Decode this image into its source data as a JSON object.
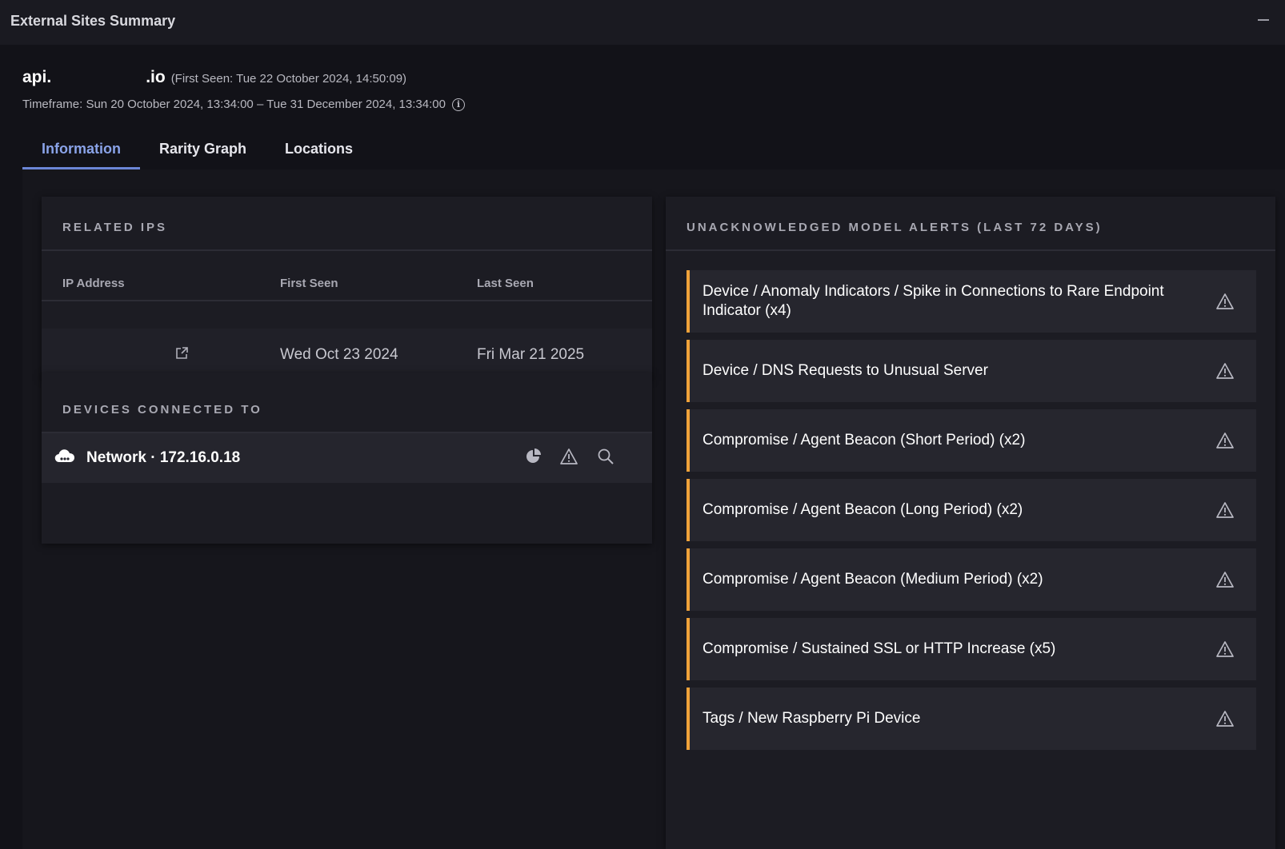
{
  "window": {
    "title": "External Sites Summary"
  },
  "site": {
    "host_prefix": "api.",
    "host_suffix": ".io",
    "first_seen": "(First Seen: Tue 22 October 2024, 14:50:09)",
    "timeframe": "Timeframe: Sun 20 October 2024, 13:34:00 – Tue 31 December 2024, 13:34:00"
  },
  "tabs": [
    {
      "label": "Information",
      "active": true
    },
    {
      "label": "Rarity Graph",
      "active": false
    },
    {
      "label": "Locations",
      "active": false
    }
  ],
  "related_ips": {
    "heading": "RELATED IPS",
    "columns": [
      "IP Address",
      "First Seen",
      "Last Seen"
    ],
    "rows": [
      {
        "ip": "",
        "first_seen": "Wed Oct 23 2024",
        "last_seen": "Fri Mar 21 2025"
      }
    ]
  },
  "devices": {
    "heading": "DEVICES CONNECTED TO",
    "items": [
      {
        "label": "Network · 172.16.0.18"
      }
    ]
  },
  "alerts": {
    "heading": "UNACKNOWLEDGED MODEL ALERTS (LAST 72 DAYS)",
    "items": [
      "Device / Anomaly Indicators / Spike in Connections to Rare Endpoint Indicator (x4)",
      "Device / DNS Requests to Unusual Server",
      "Compromise / Agent Beacon (Short Period) (x2)",
      "Compromise / Agent Beacon (Long Period) (x2)",
      "Compromise / Agent Beacon (Medium Period) (x2)",
      "Compromise / Sustained SSL or HTTP Increase (x5)",
      "Tags / New Raspberry Pi Device"
    ]
  },
  "colors": {
    "accent_tab": "#8aa3e8",
    "alert_border": "#f0a23a",
    "background": "#121218"
  },
  "icons": [
    "minimize-icon",
    "info-icon",
    "external-link-icon",
    "cloud-icon",
    "pie-chart-icon",
    "warning-icon",
    "search-icon"
  ]
}
